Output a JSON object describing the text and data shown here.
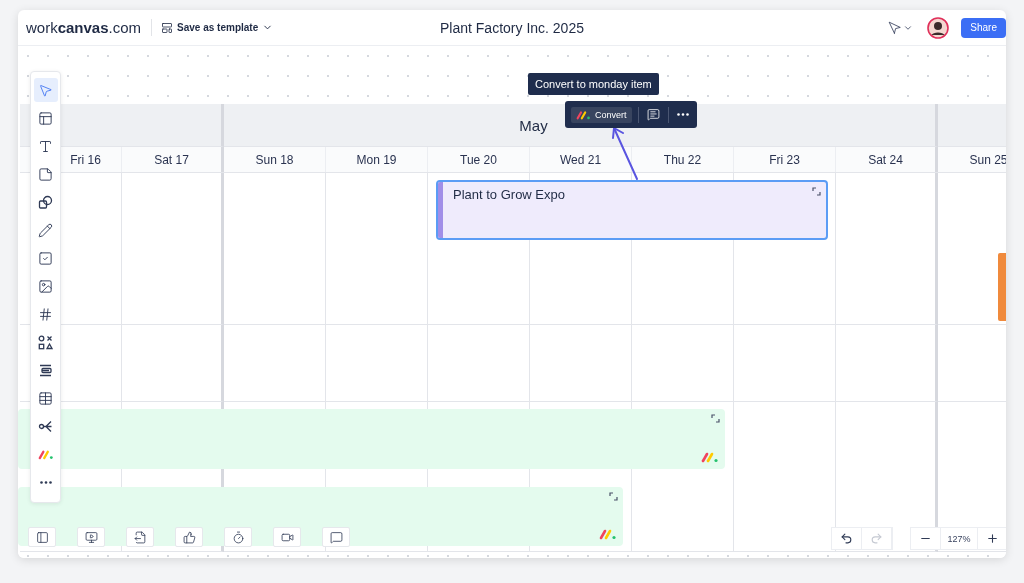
{
  "header": {
    "logo": "work**canvas**.com",
    "template_button": "Save as template",
    "title": "Plant Factory Inc. 2025",
    "share_button": "Share"
  },
  "tools": [
    {
      "kind": "select",
      "selected": true
    },
    {
      "kind": "frame",
      "selected": false
    },
    {
      "kind": "text",
      "selected": false
    },
    {
      "kind": "sticky",
      "selected": false
    },
    {
      "kind": "shapes",
      "selected": false
    },
    {
      "kind": "pen",
      "selected": false
    },
    {
      "kind": "task",
      "selected": false
    },
    {
      "kind": "image",
      "selected": false
    },
    {
      "kind": "grid",
      "selected": false
    },
    {
      "kind": "symbols",
      "selected": false
    },
    {
      "kind": "align",
      "selected": false
    },
    {
      "kind": "table",
      "selected": false
    },
    {
      "kind": "mindmap",
      "selected": false
    },
    {
      "kind": "monday",
      "selected": false
    },
    {
      "kind": "more",
      "selected": false
    }
  ],
  "calendar": {
    "week_label": "May",
    "days": [
      "Fri 16",
      "Sat 17",
      "Sun 18",
      "Mon 19",
      "Tue 20",
      "Wed 21",
      "Thu 22",
      "Fri 23",
      "Sat 24",
      "Sun 25"
    ]
  },
  "events": [
    {
      "title": "Plant to Grow Expo",
      "color": "#efebfc",
      "selected": true,
      "linked": false
    },
    {
      "color": "#e4fbee",
      "selected": false,
      "linked": true
    },
    {
      "color": "#e4fbee",
      "selected": false,
      "linked": true
    }
  ],
  "selection_toolbar": {
    "tooltip": "Convert to monday item",
    "convert_button": "Convert"
  },
  "bottom_tools": [
    {
      "kind": "panel"
    },
    {
      "kind": "present"
    },
    {
      "kind": "export"
    },
    {
      "kind": "vote"
    },
    {
      "kind": "timer"
    },
    {
      "kind": "video"
    },
    {
      "kind": "comment"
    }
  ],
  "history": {
    "undo_disabled": false,
    "redo_disabled": true
  },
  "zoom": {
    "value": "127%"
  }
}
